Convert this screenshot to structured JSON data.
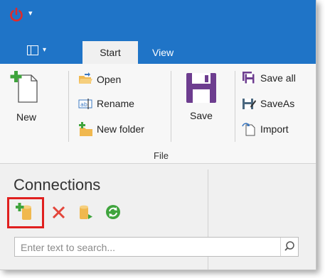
{
  "tabs": {
    "start": "Start",
    "view": "View"
  },
  "ribbon": {
    "new_label": "New",
    "open_label": "Open",
    "rename_label": "Rename",
    "new_folder_label": "New folder",
    "save_label": "Save",
    "save_all_label": "Save all",
    "save_as_label": "SaveAs",
    "import_label": "Import",
    "group_file_label": "File"
  },
  "connections": {
    "title": "Connections",
    "search_placeholder": "Enter text to search..."
  },
  "colors": {
    "titlebar": "#1f74c7",
    "power": "#e02a2a",
    "highlight": "#e0201f",
    "green": "#3fa43d",
    "red": "#e3453a",
    "folder": "#f0b84f",
    "save_purple": "#6d3d8f"
  },
  "icons": [
    "power-icon",
    "app-menu-icon",
    "new-document-icon",
    "open-folder-icon",
    "rename-icon",
    "new-folder-icon",
    "save-icon",
    "save-all-icon",
    "save-as-icon",
    "import-icon",
    "add-connection-icon",
    "delete-icon",
    "connect-icon",
    "refresh-icon",
    "search-icon"
  ]
}
